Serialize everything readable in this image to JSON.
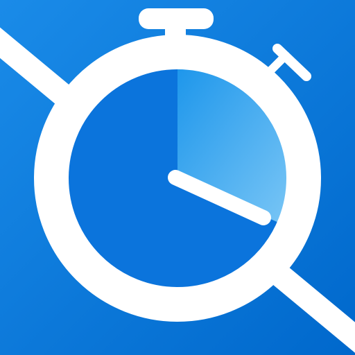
{
  "icon": {
    "name": "stopwatch-search-icon",
    "description_name": "stopwatch-magnifier",
    "elapsed_fraction": 0.27,
    "colors": {
      "background_start": "#1a8be8",
      "background_end": "#0068cc",
      "face": "#0b74dc",
      "sweep_start": "#29a3f0",
      "sweep_end": "#7cc8f6",
      "stroke": "#ffffff"
    }
  }
}
